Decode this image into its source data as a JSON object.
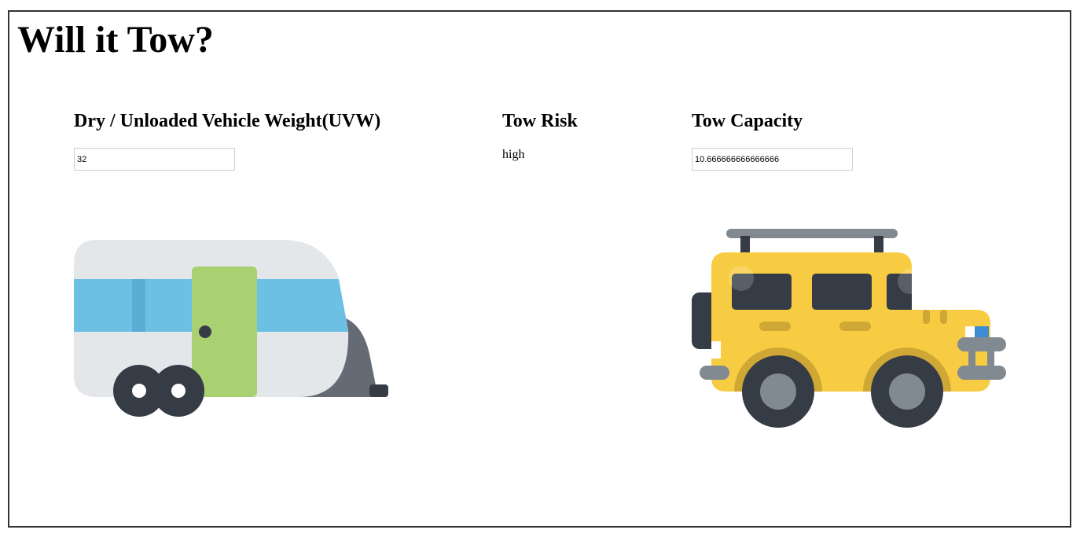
{
  "page": {
    "title": "Will it Tow?"
  },
  "uvw": {
    "label": "Dry / Unloaded Vehicle Weight(UVW)",
    "value": "32"
  },
  "risk": {
    "label": "Tow Risk",
    "value": "high"
  },
  "capacity": {
    "label": "Tow Capacity",
    "value": "10.666666666666666"
  },
  "illustrations": {
    "trailer": "camper-trailer-icon",
    "vehicle": "yellow-jeep-icon"
  },
  "colors": {
    "trailer_body": "#e4e7ea",
    "trailer_stripe": "#6cc0e4",
    "trailer_door": "#a9d071",
    "trailer_tongue": "#646b74",
    "wheel": "#353c46",
    "jeep_body": "#f7cc43",
    "jeep_shade": "#cfa735",
    "jeep_window": "#353c46",
    "jeep_rack": "#828a91"
  }
}
